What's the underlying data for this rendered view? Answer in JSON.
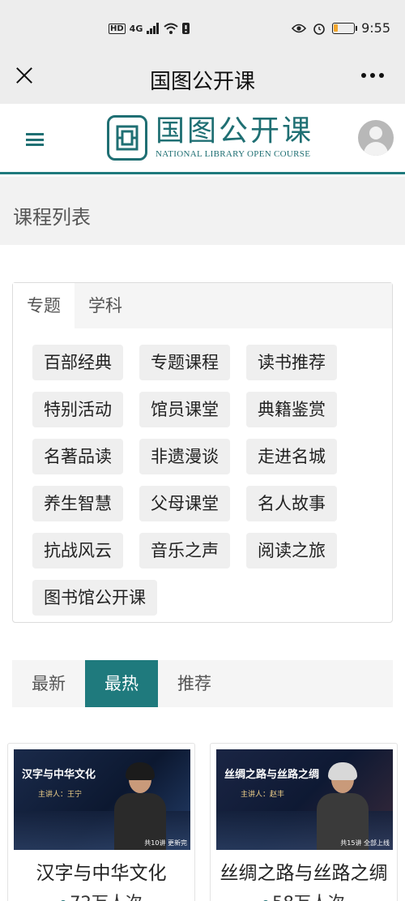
{
  "status_bar": {
    "network_badge": "HD",
    "network_type": "4G",
    "time": "9:55",
    "battery_level": 0.2,
    "battery_color": "#f2a62c"
  },
  "app_nav": {
    "title": "国图公开课",
    "close_icon": "close-icon",
    "more_icon": "more-icon"
  },
  "site_header": {
    "logo_cn": "国图公开课",
    "logo_en": "NATIONAL LIBRARY OPEN COURSE",
    "brand_color": "#1f6f73"
  },
  "section": {
    "title": "课程列表"
  },
  "topic_panel": {
    "tabs": [
      {
        "label": "专题",
        "active": true
      },
      {
        "label": "学科",
        "active": false
      }
    ],
    "tags": [
      "百部经典",
      "专题课程",
      "读书推荐",
      "特别活动",
      "馆员课堂",
      "典籍鉴赏",
      "名著品读",
      "非遗漫谈",
      "走进名城",
      "养生智慧",
      "父母课堂",
      "名人故事",
      "抗战风云",
      "音乐之声",
      "阅读之旅",
      "图书馆公开课"
    ]
  },
  "sort_tabs": [
    {
      "label": "最新",
      "active": false
    },
    {
      "label": "最热",
      "active": true
    },
    {
      "label": "推荐",
      "active": false
    }
  ],
  "courses": [
    {
      "thumb_title": "汉字与中华文化",
      "thumb_lecturer": "主讲人：王宁",
      "thumb_badge": "共10讲  更新完",
      "title": "汉字与中华文化",
      "views": "72万人次"
    },
    {
      "thumb_title": "丝绸之路与丝路之绸",
      "thumb_lecturer": "主讲人：赵丰",
      "thumb_badge": "共15讲  全部上线",
      "title": "丝绸之路与丝路之绸",
      "views": "58万人次"
    }
  ]
}
